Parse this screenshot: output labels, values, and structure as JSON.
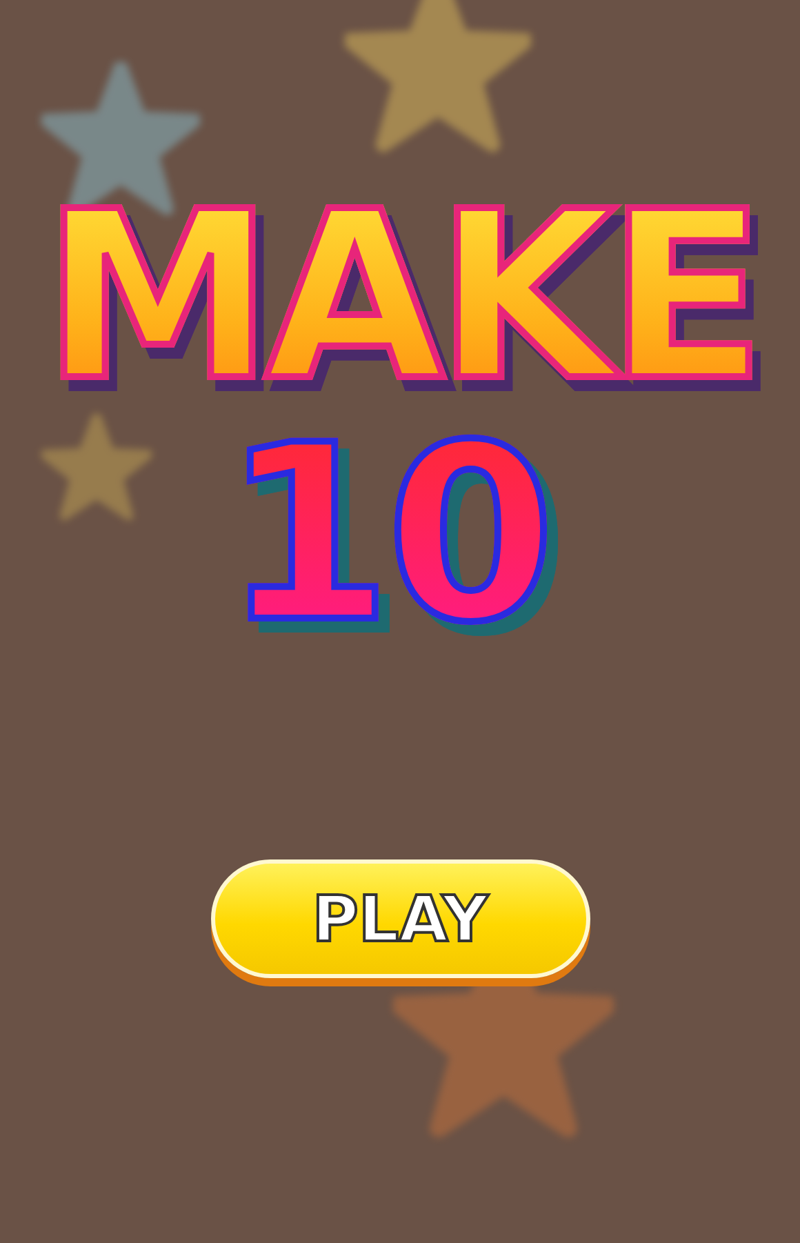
{
  "title": {
    "line_1": "MAKE",
    "line_2": "10"
  },
  "play_button": {
    "label": "PLAY"
  }
}
